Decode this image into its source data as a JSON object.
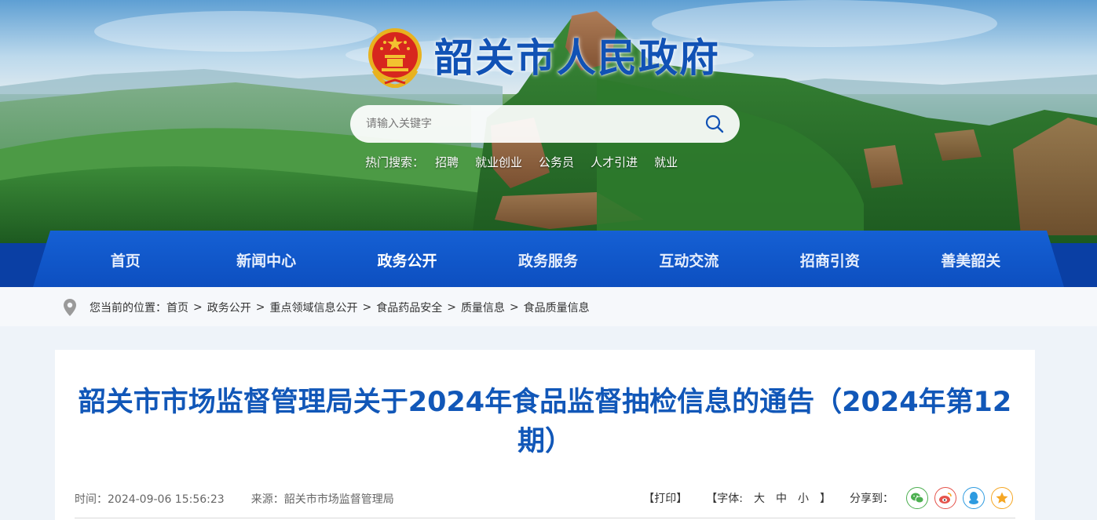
{
  "header": {
    "site_title": "韶关市人民政府",
    "search_placeholder": "请输入关键字",
    "hot_label": "热门搜索：",
    "hot_terms": [
      "招聘",
      "就业创业",
      "公务员",
      "人才引进",
      "就业"
    ]
  },
  "nav": {
    "items": [
      "首页",
      "新闻中心",
      "政务公开",
      "政务服务",
      "互动交流",
      "招商引资",
      "善美韶关"
    ],
    "active": "政务公开"
  },
  "breadcrumb": {
    "prefix": "您当前的位置：",
    "items": [
      "首页",
      "政务公开",
      "重点领域信息公开",
      "食品药品安全",
      "质量信息",
      "食品质量信息"
    ],
    "separator": ">"
  },
  "article": {
    "title": "韶关市市场监督管理局关于2024年食品监督抽检信息的通告（2024年第12期）",
    "time": "时间：2024-09-06 15:56:23",
    "source": "来源：韶关市市场监督管理局",
    "print_label": "【打印】",
    "font_label": "【字体:",
    "font_sizes": [
      "大",
      "中",
      "小"
    ],
    "font_close": "】",
    "share_label": "分享到：",
    "share_icons": [
      "wechat-icon",
      "weibo-icon",
      "qq-icon",
      "qzone-icon"
    ]
  },
  "colors": {
    "title_blue": "#1152b5",
    "nav_blue": "#1560d4",
    "article_title_blue": "#1157b8"
  }
}
